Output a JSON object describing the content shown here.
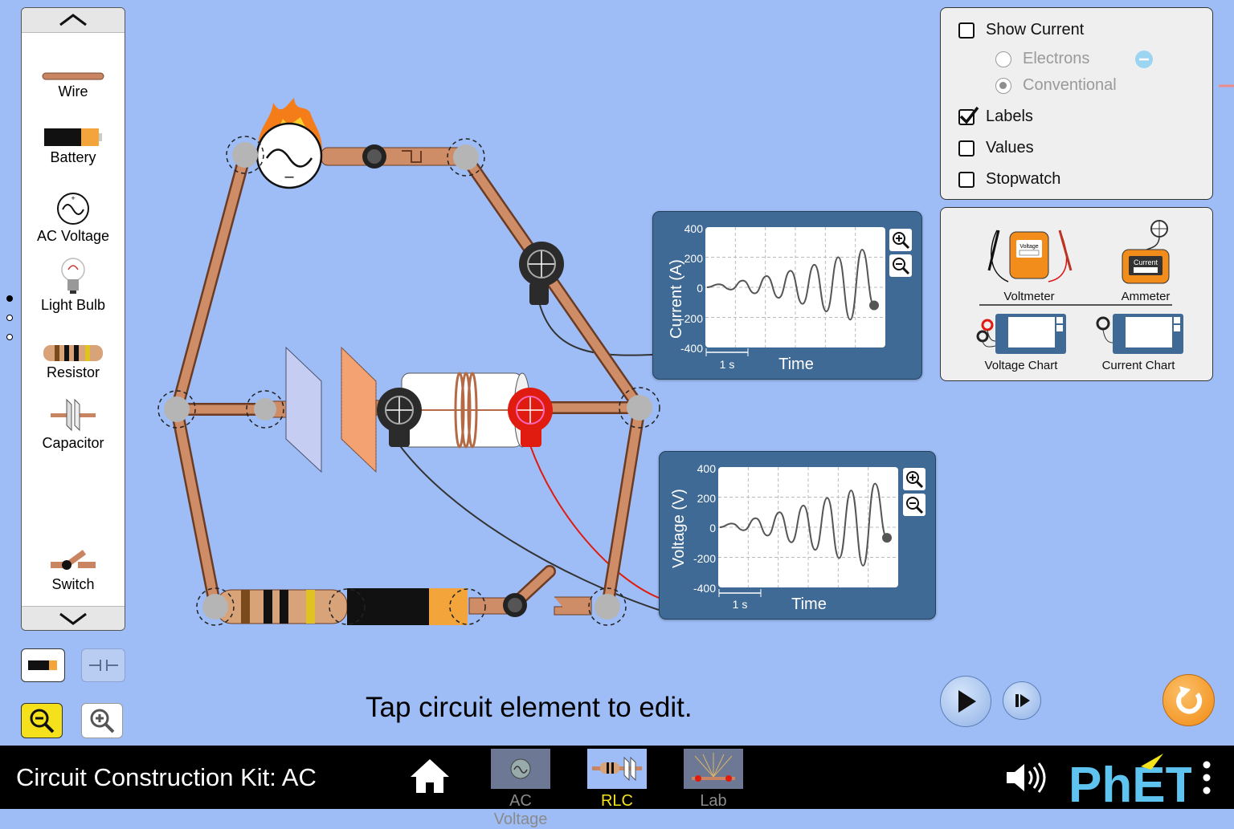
{
  "toolbox": {
    "items": [
      {
        "label": "Wire"
      },
      {
        "label": "Battery"
      },
      {
        "label": "AC Voltage"
      },
      {
        "label": "Light Bulb"
      },
      {
        "label": "Resistor"
      },
      {
        "label": "Capacitor"
      },
      {
        "label": "Switch"
      }
    ]
  },
  "display_panel": {
    "show_current": "Show Current",
    "electrons": "Electrons",
    "conventional": "Conventional",
    "labels": "Labels",
    "values": "Values",
    "stopwatch": "Stopwatch",
    "labels_checked": true,
    "conventional_selected": true
  },
  "sensors_panel": {
    "voltmeter": "Voltmeter",
    "ammeter": "Ammeter",
    "voltage_chart": "Voltage Chart",
    "current_chart": "Current Chart",
    "voltmeter_face": "Voltage",
    "ammeter_face": "Current"
  },
  "current_chart": {
    "ylabel": "Current (A)",
    "xlabel": "Time",
    "yticks": [
      "400",
      "200",
      "0",
      "-200",
      "-400"
    ],
    "scale_label": "1 s"
  },
  "voltage_chart": {
    "ylabel": "Voltage (V)",
    "xlabel": "Time",
    "yticks": [
      "400",
      "200",
      "0",
      "-200",
      "-400"
    ],
    "scale_label": "1 s"
  },
  "chart_data": [
    {
      "type": "line",
      "ylabel": "Current (A)",
      "xlabel": "Time",
      "ylim": [
        -400,
        400
      ],
      "series": [
        {
          "values": [
            0,
            20,
            -15,
            45,
            -40,
            75,
            -70,
            110,
            -110,
            150,
            -160,
            200,
            -215,
            250,
            -120
          ]
        }
      ]
    },
    {
      "type": "line",
      "ylabel": "Voltage (V)",
      "xlabel": "Time",
      "ylim": [
        -400,
        400
      ],
      "series": [
        {
          "values": [
            0,
            25,
            -20,
            60,
            -55,
            100,
            -100,
            145,
            -150,
            195,
            -205,
            245,
            -255,
            290,
            -70
          ]
        }
      ]
    }
  ],
  "hint": "Tap circuit element to edit.",
  "navbar": {
    "title": "Circuit Construction Kit: AC",
    "tabs": [
      {
        "label": "AC Voltage",
        "color": "#8a8a8a"
      },
      {
        "label": "RLC",
        "color": "#f5e31b"
      },
      {
        "label": "Lab",
        "color": "#8a8a8a"
      }
    ],
    "brand": "PhET"
  }
}
